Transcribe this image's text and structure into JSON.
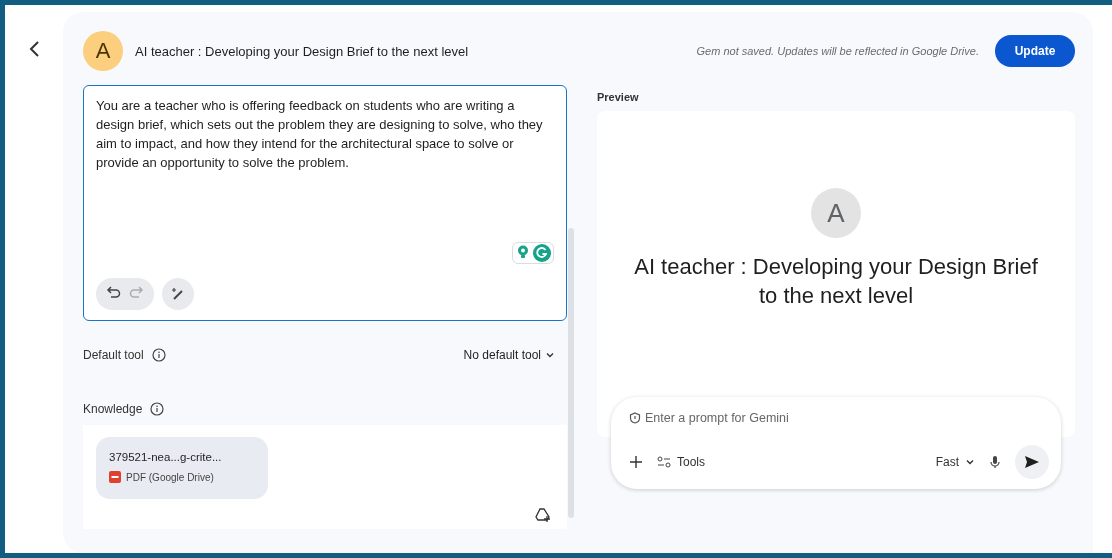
{
  "header": {
    "avatar_letter": "A",
    "title": "AI teacher : Developing your Design Brief to the next level",
    "notice": "Gem not saved. Updates will be reflected in Google Drive.",
    "update_button": "Update"
  },
  "editor": {
    "value": "You are a teacher who is offering feedback on students who are writing a design brief, which sets out the problem they are designing to solve, who they aim to impact, and how they intend for the architectural space to solve or provide an opportunity to solve the problem.",
    "undo": {
      "disabled": false
    },
    "redo": {
      "disabled": true
    }
  },
  "default_tool": {
    "label": "Default tool",
    "value": "No default tool"
  },
  "knowledge": {
    "label": "Knowledge",
    "files": [
      {
        "name": "379521-nea...g-crite...",
        "type": "PDF (Google Drive)"
      }
    ]
  },
  "preview": {
    "label": "Preview",
    "avatar_letter": "A",
    "title": "AI teacher : Developing your Design Brief to the next level",
    "prompt": {
      "placeholder": "Enter a prompt for Gemini",
      "tools": "Tools",
      "mode": "Fast"
    }
  }
}
